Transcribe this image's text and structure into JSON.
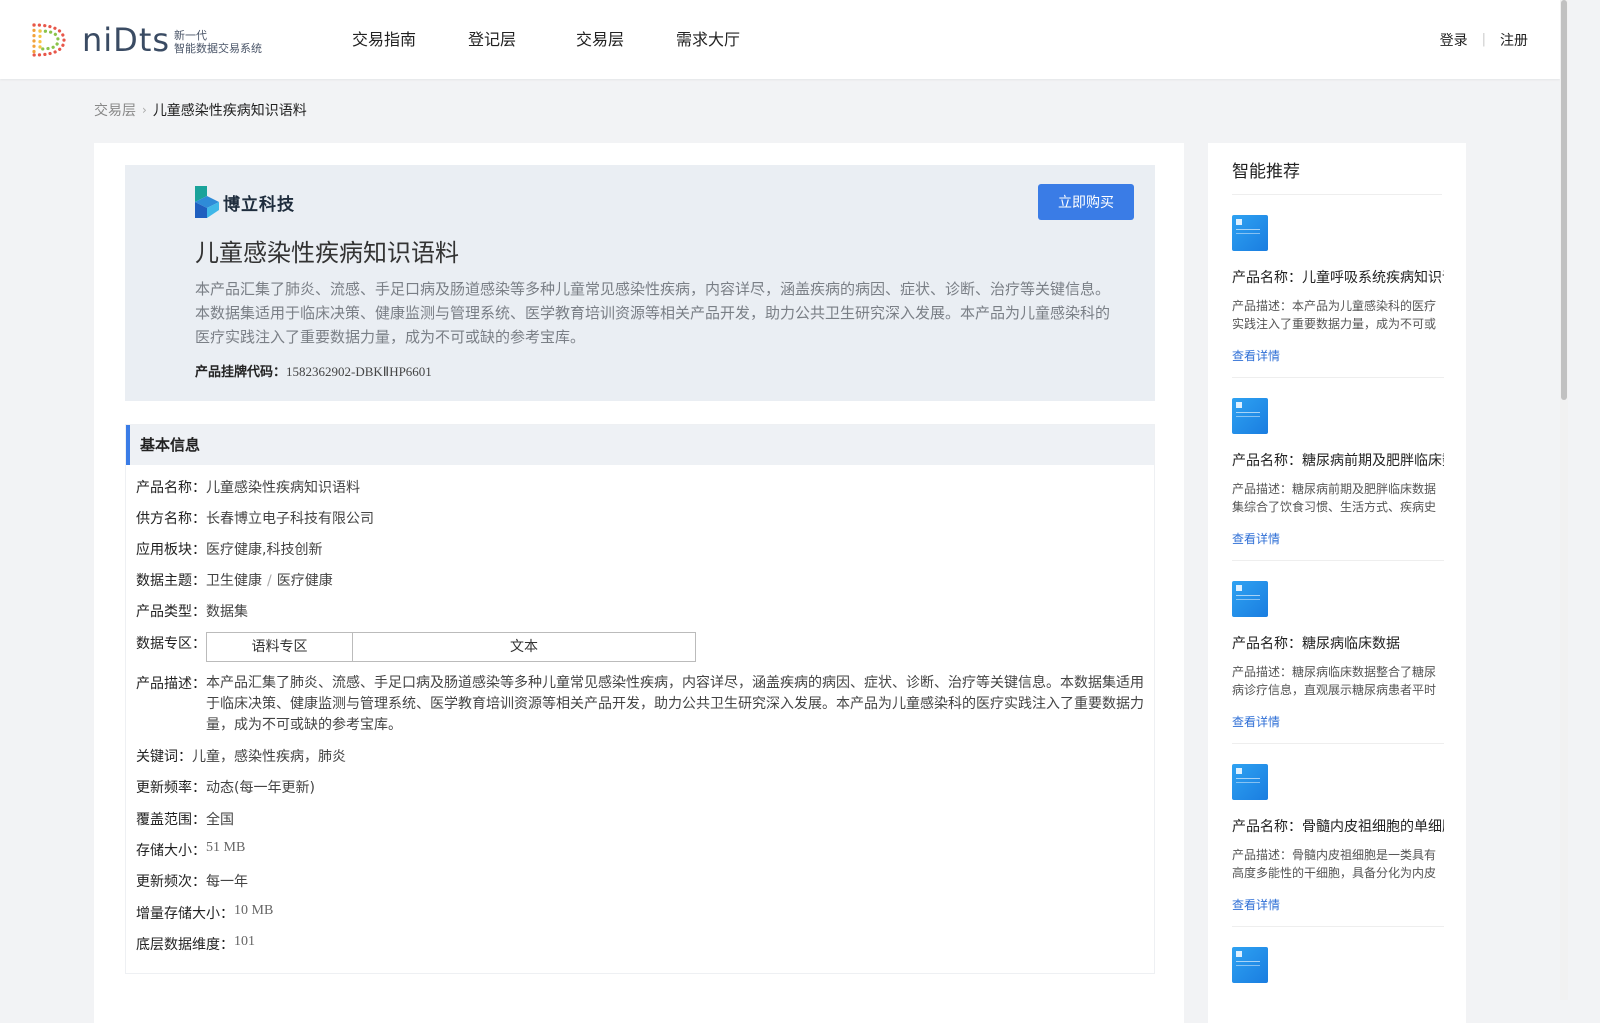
{
  "header": {
    "logo_word": "niDts",
    "logo_sub_1": "新一代",
    "logo_sub_2": "智能数据交易系统",
    "nav": [
      "交易指南",
      "登记层",
      "交易层",
      "需求大厅"
    ],
    "login": "登录",
    "register": "注册",
    "separator": "|"
  },
  "breadcrumb": {
    "parent": "交易层",
    "arrow": "›",
    "current": "儿童感染性疾病知识语料"
  },
  "hero": {
    "brand_name": "博立科技",
    "title": "儿童感染性疾病知识语料",
    "buy_label": "立即购买",
    "description": "本产品汇集了肺炎、流感、手足口病及肠道感染等多种儿童常见感染性疾病，内容详尽，涵盖疾病的病因、症状、诊断、治疗等关键信息。本数据集适用于临床决策、健康监测与管理系统、医学教育培训资源等相关产品开发，助力公共卫生研究深入发展。本产品为儿童感染科的医疗实践注入了重要数据力量，成为不可或缺的参考宝库。",
    "code_label": "产品挂牌代码：",
    "code_value": "1582362902-DBKⅡHP6601"
  },
  "basic_info": {
    "heading": "基本信息",
    "product_name_label": "产品名称：",
    "product_name": "儿童感染性疾病知识语料",
    "supplier_label": "供方名称：",
    "supplier": "长春博立电子科技有限公司",
    "sector_label": "应用板块：",
    "sector": "医疗健康,科技创新",
    "theme_label": "数据主题：",
    "theme_1": "卫生健康",
    "theme_sep": "/",
    "theme_2": "医疗健康",
    "type_label": "产品类型：",
    "type": "数据集",
    "zone_label": "数据专区：",
    "zone_1": "语料专区",
    "zone_2": "文本",
    "desc_label": "产品描述：",
    "desc": "本产品汇集了肺炎、流感、手足口病及肠道感染等多种儿童常见感染性疾病，内容详尽，涵盖疾病的病因、症状、诊断、治疗等关键信息。本数据集适用于临床决策、健康监测与管理系统、医学教育培训资源等相关产品开发，助力公共卫生研究深入发展。本产品为儿童感染科的医疗实践注入了重要数据力量，成为不可或缺的参考宝库。",
    "keywords_label": "关键词：",
    "keywords": "儿童，感染性疾病，肺炎",
    "update_freq_label": "更新频率：",
    "update_freq": "动态(每一年更新)",
    "coverage_label": "覆盖范围：",
    "coverage": "全国",
    "storage_label": "存储大小：",
    "storage": "51 MB",
    "update_times_label": "更新频次：",
    "update_times": "每一年",
    "inc_storage_label": "增量存储大小：",
    "inc_storage": "10 MB",
    "dims_label": "底层数据维度：",
    "dims": "101"
  },
  "sidebar": {
    "title": "智能推荐",
    "items": [
      {
        "name": "产品名称：儿童呼吸系统疾病知识语料",
        "desc": "产品描述：本产品为儿童感染科的医疗实践注入了重要数据力量，成为不可或缺的参考宝库。",
        "link": "查看详情"
      },
      {
        "name": "产品名称：糖尿病前期及肥胖临床数据",
        "desc": "产品描述：糖尿病前期及肥胖临床数据集综合了饮食习惯、生活方式、疾病史等信息。",
        "link": "查看详情"
      },
      {
        "name": "产品名称：糖尿病临床数据",
        "desc": "产品描述：糖尿病临床数据整合了糖尿病诊疗信息，直观展示糖尿病患者平时诊疗数据。",
        "link": "查看详情"
      },
      {
        "name": "产品名称：骨髓内皮祖细胞的单细胞数据",
        "desc": "产品描述：骨髓内皮祖细胞是一类具有高度多能性的干细胞，具备分化为内皮细胞的能力。",
        "link": "查看详情"
      }
    ]
  },
  "colors": {
    "accent": "#3a7ce6",
    "link": "#2f6fd6",
    "hero_bg": "#eaeef3",
    "page_bg": "#f2f3f5"
  }
}
